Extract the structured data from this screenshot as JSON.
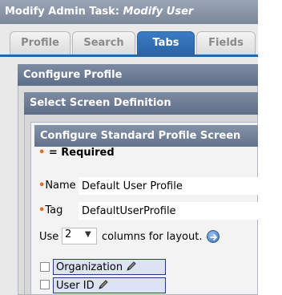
{
  "window": {
    "title_prefix": "Modify Admin Task: ",
    "title_subject": "Modify User"
  },
  "tabs": [
    {
      "label": "Profile",
      "active": false
    },
    {
      "label": "Search",
      "active": false
    },
    {
      "label": "Tabs",
      "active": true
    },
    {
      "label": "Fields",
      "active": false
    }
  ],
  "panels": {
    "configure_profile": "Configure Profile",
    "select_screen": "Select Screen Definition",
    "configure_standard": "Configure Standard Profile Screen"
  },
  "required_note": {
    "marker": "•",
    "text": " = Required"
  },
  "form": {
    "name": {
      "marker": "•",
      "label": "Name",
      "value": "Default User Profile"
    },
    "tag": {
      "marker": "•",
      "label": "Tag",
      "value": "DefaultUserProfile"
    },
    "layout": {
      "prefix": "Use",
      "selected": "2",
      "suffix": "columns for layout."
    }
  },
  "attributes": [
    {
      "label": "Organization",
      "checked": false,
      "icon": "pencil-icon"
    },
    {
      "label": "User ID",
      "checked": false,
      "icon": "pencil-icon"
    }
  ],
  "colors": {
    "accent": "#2c64a8",
    "panel_header": "#5e6d87",
    "required": "#e46b22"
  }
}
